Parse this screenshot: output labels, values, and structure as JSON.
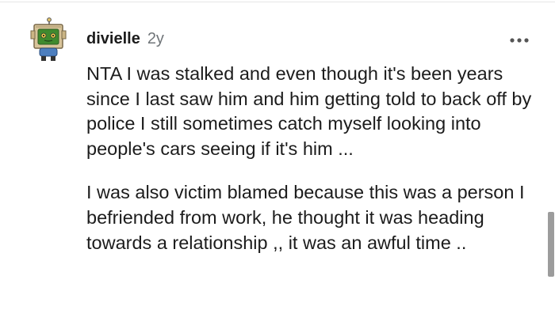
{
  "comment": {
    "author": "divielle",
    "age": "2y",
    "paragraphs": [
      "NTA I was stalked and even though it's been years since I last saw him and him getting told to back off by police I still sometimes catch myself looking into people's cars seeing if it's him ...",
      "I was also victim blamed because this was a person I befriended from work, he thought it was heading towards a relationship ,, it was an awful time .."
    ],
    "avatar_icon": "snoo-box-avatar-icon",
    "more_icon": "more-options-icon"
  },
  "colors": {
    "text": "#1c1c1c",
    "meta": "#707579",
    "avatar_green": "#3f8a2e",
    "avatar_tan": "#c9b48a"
  }
}
